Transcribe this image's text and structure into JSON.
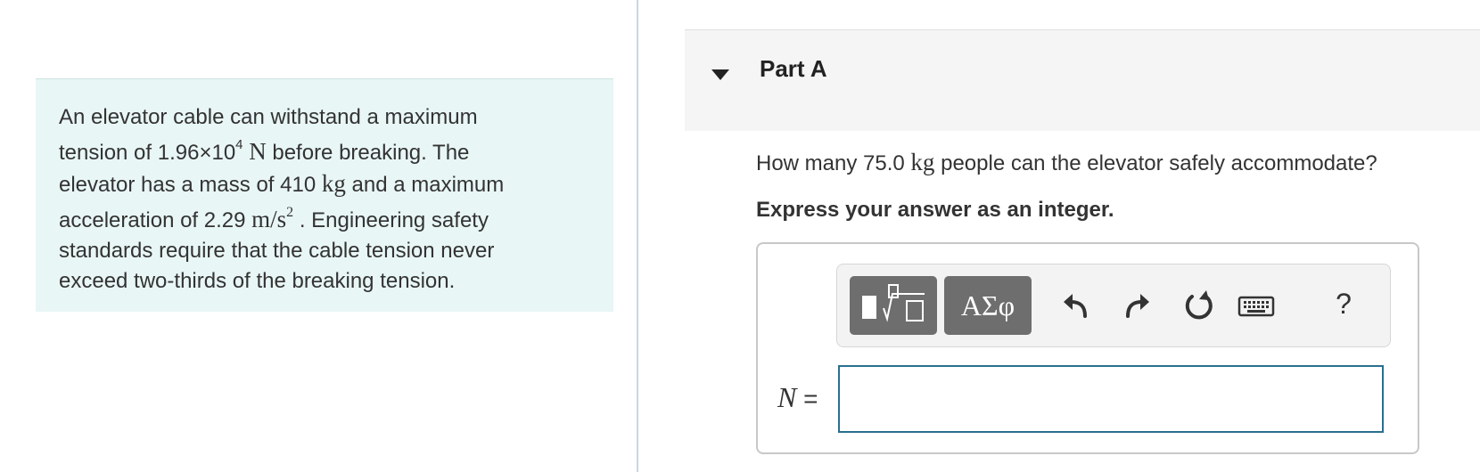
{
  "problem": {
    "line1": "An elevator cable can withstand a maximum",
    "line2_pre": "tension of 1.96×10",
    "line2_exp": "4",
    "line2_unit": "N",
    "line2_post": " before breaking. The",
    "line3_pre": "elevator has a mass of 410 ",
    "line3_unit": "kg",
    "line3_post": " and a maximum",
    "line4_pre": "acceleration of 2.29 ",
    "line4_unit": "m/s",
    "line4_exp": "2",
    "line4_post": " . Engineering safety",
    "line5": "standards require that the cable tension never",
    "line6": "exceed two-thirds of the breaking tension."
  },
  "part": {
    "title": "Part A"
  },
  "question": {
    "pre": "How many 75.0 ",
    "unit": "kg",
    "post": " people can the elevator safely accommodate?",
    "instruction": "Express your answer as an integer."
  },
  "answer": {
    "variable": "N",
    "equals": " =",
    "value": "",
    "placeholder": ""
  },
  "toolbar": {
    "symbols_label": "ΑΣφ",
    "help_label": "?",
    "icons": [
      "templates-icon",
      "greek-symbols-icon",
      "undo-icon",
      "redo-icon",
      "reset-icon",
      "keyboard-icon",
      "help-icon"
    ]
  }
}
